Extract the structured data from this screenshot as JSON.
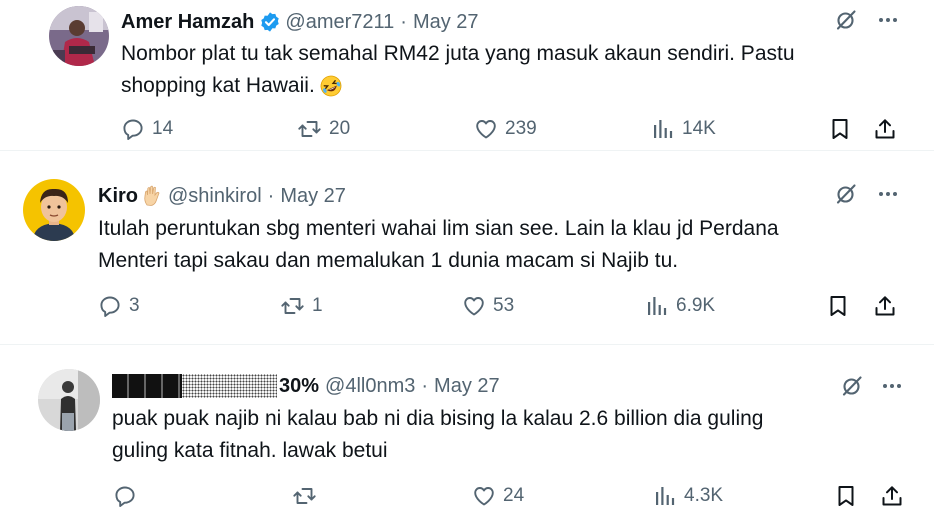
{
  "tweets": [
    {
      "name": "Amer Hamzah",
      "handle": "@amer7211",
      "separator": "·",
      "date": "May 27",
      "verified": true,
      "text_line1": "Nombor plat tu tak semahal RM42 juta yang masuk akaun sendiri. Pastu",
      "text_line2": "shopping kat Hawaii.",
      "text_emoji": "rolling-on-floor-laughing-emoji",
      "replies": "14",
      "reposts": "20",
      "likes": "239",
      "views": "14K"
    },
    {
      "name": "Kiro",
      "name_emoji": "raised-hand-emoji",
      "handle": "@shinkirol",
      "separator": "·",
      "date": "May 27",
      "text_line1": "Itulah peruntukan sbg menteri wahai lim sian see. Lain la klau jd Perdana",
      "text_line2": "Menteri tapi sakau dan memalukan 1 dunia macam si Najib tu.",
      "replies": "3",
      "reposts": "1",
      "likes": "53",
      "views": "6.9K"
    },
    {
      "name_suffix": "30%",
      "handle": "@4ll0nm3",
      "separator": "·",
      "date": "May 27",
      "text_line1": "puak puak najib ni kalau bab ni dia bising la kalau 2.6 billion dia guling",
      "text_line2": "guling kata fitnah. lawak betui",
      "replies": "",
      "reposts": "",
      "likes": "24",
      "views": "4.3K"
    }
  ],
  "icons": {
    "grok": "grok-slash-icon",
    "more": "more-dots-icon",
    "reply": "reply-icon",
    "repost": "repost-icon",
    "like": "like-heart-icon",
    "views": "views-chart-icon",
    "bookmark": "bookmark-icon",
    "share": "share-icon"
  },
  "colors": {
    "text": "#0f1419",
    "secondary": "#536471",
    "verified": "#1d9bf0"
  }
}
